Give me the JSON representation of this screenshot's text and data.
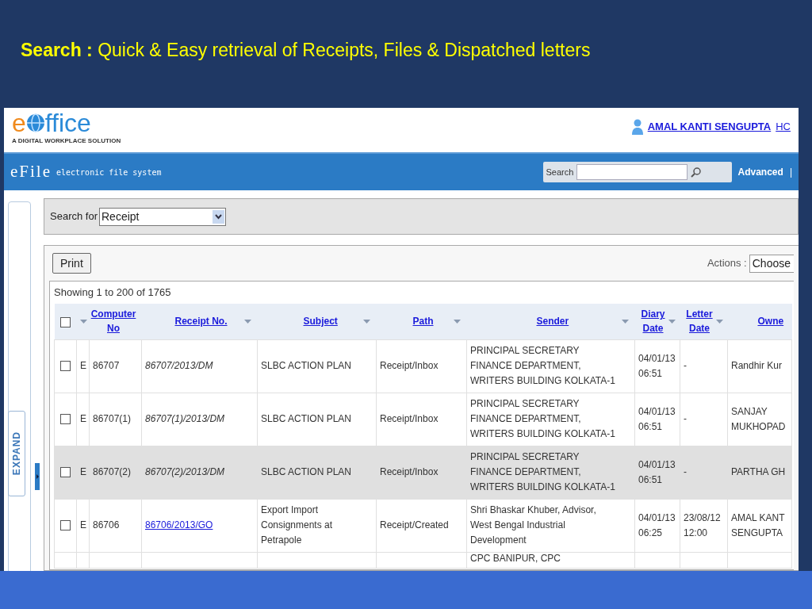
{
  "slide_title": "**Search :** Quick & Easy retrieval of Receipts, Files & Dispatched letters",
  "logo": {
    "prefix": "e",
    "suffix": "ffice",
    "tagline": "A DIGITAL WORKPLACE SOLUTION"
  },
  "user": {
    "name": "AMAL KANTI SENGUPTA",
    "extra": "HC"
  },
  "app_bar": {
    "title": "eFile",
    "subtitle": "electronic file system",
    "search_label": "Search",
    "advanced": "Advanced",
    "separator": "|"
  },
  "sidebar": {
    "expand_label": "EXPAND"
  },
  "search_for": {
    "label": "Search for",
    "value": "Receipt"
  },
  "toolbar": {
    "print": "Print",
    "actions_label": "Actions :",
    "actions_value": "Choose"
  },
  "select_all_checked": false,
  "showing": "Showing 1 to 200 of 1765",
  "columns": [
    "Computer No",
    "Receipt No.",
    "Subject",
    "Path",
    "Sender",
    "Diary Date",
    "Letter Date",
    "Owne"
  ],
  "rows": [
    {
      "checked": false,
      "selected": false,
      "type": "E",
      "computer_no": "86707",
      "receipt_no": "86707/2013/DM",
      "link": false,
      "subject": "SLBC ACTION PLAN",
      "path": "Receipt/Inbox",
      "sender": "PRINCIPAL SECRETARY\nFINANCE DEPARTMENT,\nWRITERS BUILDING KOLKATA-1",
      "diary_date": "04/01/13 06:51",
      "letter_date": "-",
      "owner": "Randhir Kur"
    },
    {
      "checked": false,
      "selected": false,
      "type": "E",
      "computer_no": "86707(1)",
      "receipt_no": "86707(1)/2013/DM",
      "link": false,
      "subject": "SLBC ACTION PLAN",
      "path": "Receipt/Inbox",
      "sender": "PRINCIPAL SECRETARY\nFINANCE DEPARTMENT,\nWRITERS BUILDING KOLKATA-1",
      "diary_date": "04/01/13 06:51",
      "letter_date": "-",
      "owner": "SANJAY MUKHOPAD"
    },
    {
      "checked": false,
      "selected": true,
      "type": "E",
      "computer_no": "86707(2)",
      "receipt_no": "86707(2)/2013/DM",
      "link": false,
      "subject": "SLBC ACTION PLAN",
      "path": "Receipt/Inbox",
      "sender": "PRINCIPAL SECRETARY\nFINANCE DEPARTMENT,\nWRITERS BUILDING KOLKATA-1",
      "diary_date": "04/01/13 06:51",
      "letter_date": "-",
      "owner": "PARTHA GH"
    },
    {
      "checked": false,
      "selected": false,
      "type": "E",
      "computer_no": "86706",
      "receipt_no": "86706/2013/GO",
      "link": true,
      "subject": "Export Import Consignments at Petrapole",
      "path": "Receipt/Created",
      "sender": "Shri Bhaskar Khuber, Advisor,\nWest Bengal Industrial\nDevelopment",
      "diary_date": "04/01/13 06:25",
      "letter_date": "23/08/12 12:00",
      "owner": "AMAL KANT SENGUPTA"
    }
  ],
  "partial_row": {
    "sender": "CPC BANIPUR, CPC"
  }
}
